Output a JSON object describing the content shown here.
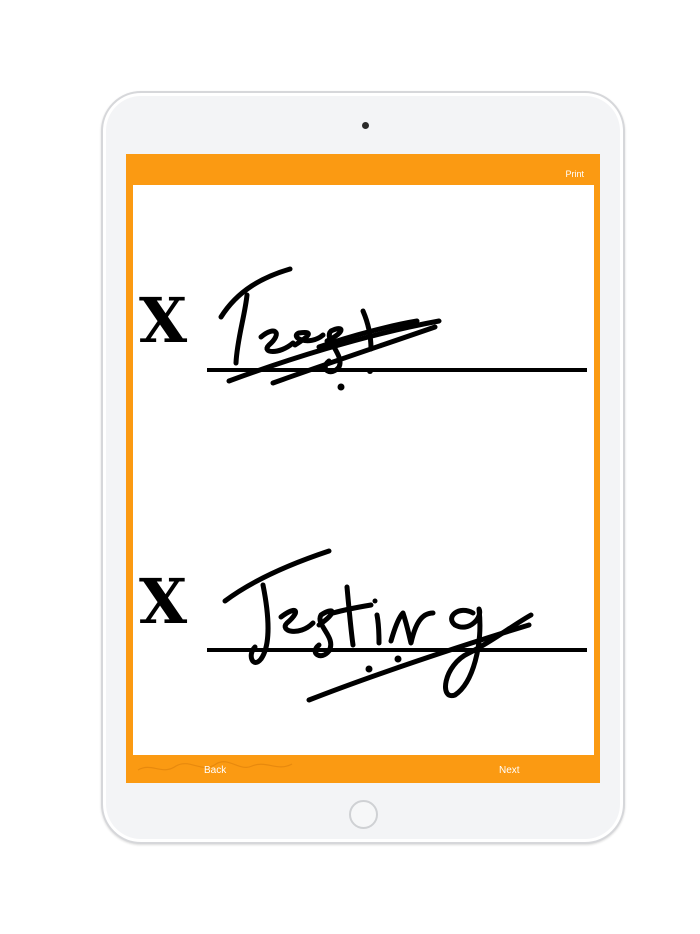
{
  "toolbar": {
    "print_label": "Print"
  },
  "signature_lines": [
    {
      "mark": "X",
      "handwriting": "Test"
    },
    {
      "mark": "X",
      "handwriting": "Testing"
    }
  ],
  "navigation": {
    "back_label": "Back",
    "next_label": "Next"
  },
  "colors": {
    "accent": "#fb9a12",
    "ink": "#000000",
    "device_frame": "#f3f4f6"
  },
  "icons": [
    "camera-icon",
    "home-button-icon"
  ]
}
